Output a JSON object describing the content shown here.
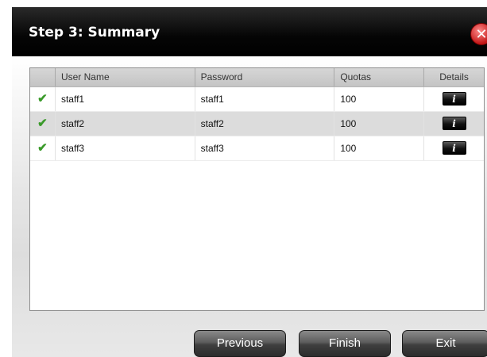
{
  "dialog": {
    "title": "Step 3: Summary",
    "close_icon": "close-icon"
  },
  "table": {
    "columns": [
      "",
      "User Name",
      "Password",
      "Quotas",
      "Details"
    ],
    "rows": [
      {
        "status_icon": "check-icon",
        "user_name": "staff1",
        "password": "staff1",
        "quota": "100",
        "details_icon": "info-icon",
        "details_label": "i"
      },
      {
        "status_icon": "check-icon",
        "user_name": "staff2",
        "password": "staff2",
        "quota": "100",
        "details_icon": "info-icon",
        "details_label": "i"
      },
      {
        "status_icon": "check-icon",
        "user_name": "staff3",
        "password": "staff3",
        "quota": "100",
        "details_icon": "info-icon",
        "details_label": "i"
      }
    ]
  },
  "buttons": {
    "previous": "Previous",
    "finish": "Finish",
    "exit": "Exit"
  },
  "colors": {
    "titlebar": "#000000",
    "close_button": "#d01c1c",
    "check": "#3a9a2a"
  }
}
